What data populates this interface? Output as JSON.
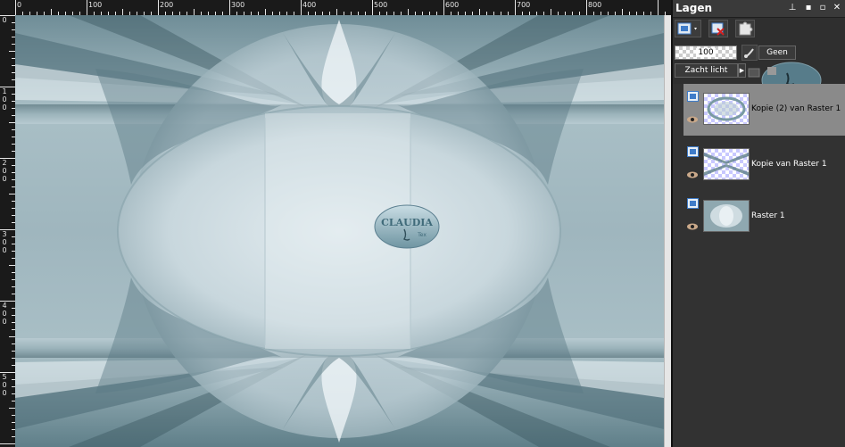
{
  "ruler": {
    "top_labels": [
      "0",
      "100",
      "200",
      "300",
      "400",
      "500",
      "600",
      "700",
      "800"
    ],
    "left_labels": [
      [
        "0"
      ],
      [
        "1",
        "0",
        "0"
      ],
      [
        "2",
        "0",
        "0"
      ],
      [
        "3",
        "0",
        "0"
      ],
      [
        "4",
        "0",
        "0"
      ],
      [
        "5",
        "0",
        "0"
      ]
    ]
  },
  "canvas": {
    "watermark_main": "CLAUDIA",
    "watermark_sub": "Tex",
    "colors": {
      "deep": "#3d5a63",
      "mid": "#8fa9b1",
      "light": "#dfe9ee",
      "pale": "#bccdd4"
    }
  },
  "panel": {
    "title": "Lagen",
    "header_buttons": [
      "pin",
      "minimize",
      "close"
    ],
    "opacity_value": "100",
    "mask_label": "Geen",
    "blend_mode": "Zacht licht",
    "layers": [
      {
        "name": "Kopie (2) van Raster 1",
        "selected": true
      },
      {
        "name": "Kopie van Raster 1",
        "selected": false
      },
      {
        "name": "Raster 1",
        "selected": false
      }
    ]
  }
}
